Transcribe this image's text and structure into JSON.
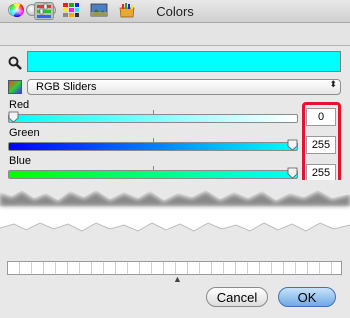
{
  "window": {
    "title": "Colors"
  },
  "toolbar": {
    "items": [
      "color-wheel-icon",
      "sliders-icon",
      "palettes-icon",
      "image-palettes-icon",
      "crayons-icon"
    ],
    "selected": "sliders-icon"
  },
  "current_color": "#00ffff",
  "mode": {
    "selected": "RGB Sliders"
  },
  "sliders": [
    {
      "label": "Red",
      "value": "0",
      "fraction": 0.0
    },
    {
      "label": "Green",
      "value": "255",
      "fraction": 1.0
    },
    {
      "label": "Blue",
      "value": "255",
      "fraction": 1.0
    }
  ],
  "highlight_color": "#e8102a",
  "buttons": {
    "cancel": "Cancel",
    "ok": "OK"
  }
}
